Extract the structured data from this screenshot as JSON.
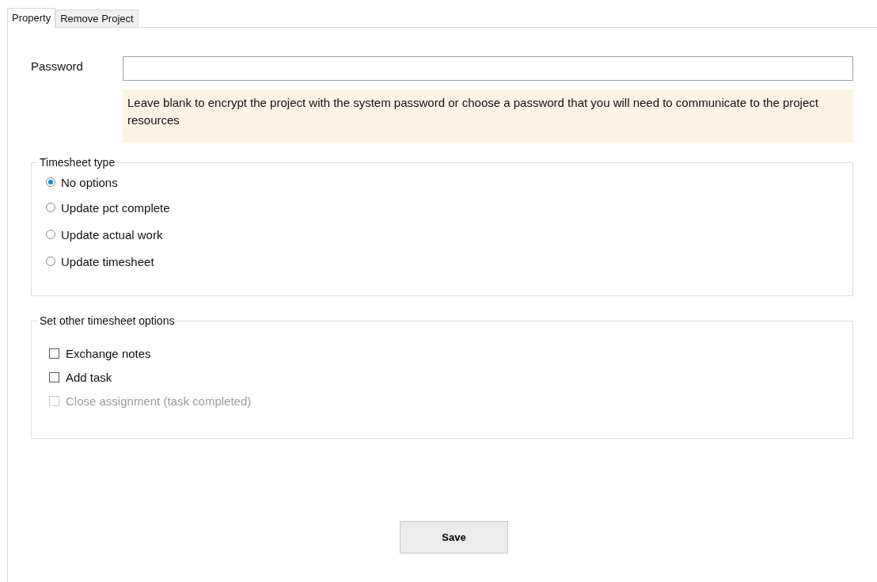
{
  "tabs": [
    {
      "label": "Property",
      "selected": true
    },
    {
      "label": "Remove Project",
      "selected": false
    }
  ],
  "password": {
    "label": "Password",
    "hint": "Leave blank to encrypt the project with the system password or choose a password that you will need to communicate to the project resources"
  },
  "timesheet_type": {
    "title": "Timesheet type",
    "options": [
      {
        "label": "No options",
        "selected": true
      },
      {
        "label": "Update pct complete",
        "selected": false
      },
      {
        "label": "Update actual work",
        "selected": false
      },
      {
        "label": "Update timesheet",
        "selected": false
      }
    ]
  },
  "other_options": {
    "title": "Set other timesheet options",
    "options": [
      {
        "label": "Exchange notes",
        "checked": false,
        "disabled": false
      },
      {
        "label": "Add task",
        "checked": false,
        "disabled": false
      },
      {
        "label": "Close assignment (task completed)",
        "checked": false,
        "disabled": true
      }
    ]
  },
  "save_button": "Save"
}
